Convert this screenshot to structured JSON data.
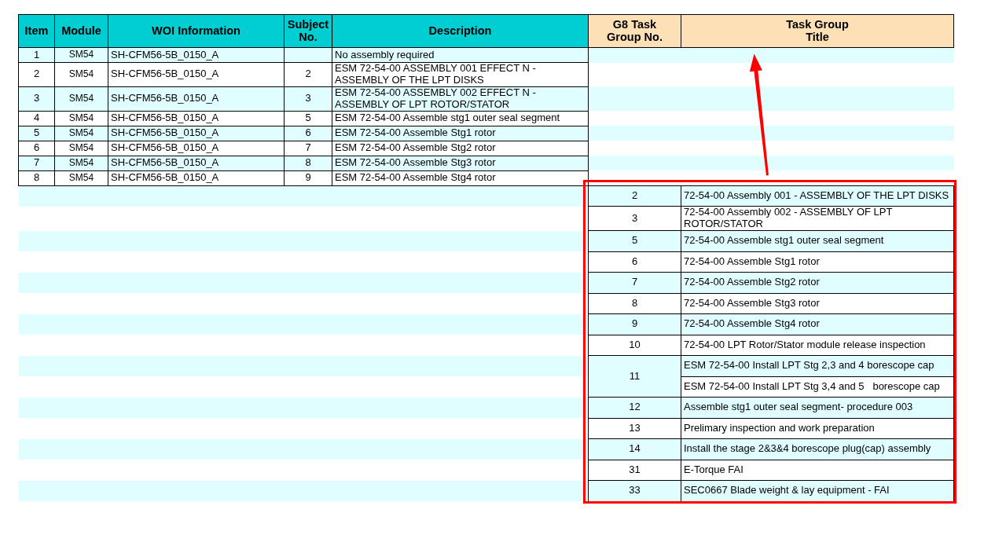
{
  "columns": [
    "Item",
    "Module",
    "WOI Information",
    "Subject No.",
    "Description"
  ],
  "task_columns": [
    "G8 Task Group No.",
    "Task Group Title"
  ],
  "items": [
    {
      "item": "1",
      "module": "SM54",
      "woi": "SH-CFM56-5B_0150_A",
      "description": "No assembly required"
    },
    {
      "item": "2",
      "module": "SM54",
      "woi": "SH-CFM56-5B_0150_A",
      "subject_no": "2",
      "description": "ESM 72-54-00 ASSEMBLY 001 EFFECT N - ASSEMBLY OF THE LPT DISKS"
    },
    {
      "item": "3",
      "module": "SM54",
      "woi": "SH-CFM56-5B_0150_A",
      "subject_no": "3",
      "description": "ESM 72-54-00 ASSEMBLY 002 EFFECT N - ASSEMBLY OF LPT ROTOR/STATOR"
    },
    {
      "item": "4",
      "module": "SM54",
      "woi": "SH-CFM56-5B_0150_A",
      "subject_no": "5",
      "description": "ESM 72-54-00 Assemble stg1 outer seal segment"
    },
    {
      "item": "5",
      "module": "SM54",
      "woi": "SH-CFM56-5B_0150_A",
      "subject_no": "6",
      "description": "ESM 72-54-00 Assemble Stg1 rotor"
    },
    {
      "item": "6",
      "module": "SM54",
      "woi": "SH-CFM56-5B_0150_A",
      "subject_no": "7",
      "description": "ESM 72-54-00 Assemble Stg2 rotor"
    },
    {
      "item": "7",
      "module": "SM54",
      "woi": "SH-CFM56-5B_0150_A",
      "subject_no": "8",
      "description": "ESM 72-54-00 Assemble Stg3 rotor"
    },
    {
      "item": "8",
      "module": "SM54",
      "woi": "SH-CFM56-5B_0150_A",
      "subject_no": "9",
      "description": "ESM 72-54-00 Assemble Stg4 rotor"
    }
  ],
  "task_groups": [
    {
      "number": "2",
      "titles": [
        "72-54-00 Assembly 001 - ASSEMBLY OF THE LPT DISKS"
      ]
    },
    {
      "number": "3",
      "titles": [
        "72-54-00 Assembly 002 - ASSEMBLY OF LPT ROTOR/STATOR"
      ]
    },
    {
      "number": "5",
      "titles": [
        "72-54-00 Assemble stg1 outer seal segment"
      ]
    },
    {
      "number": "6",
      "titles": [
        "72-54-00 Assemble Stg1 rotor"
      ]
    },
    {
      "number": "7",
      "titles": [
        "72-54-00 Assemble Stg2 rotor"
      ]
    },
    {
      "number": "8",
      "titles": [
        "72-54-00 Assemble Stg3 rotor"
      ]
    },
    {
      "number": "9",
      "titles": [
        "72-54-00 Assemble Stg4 rotor"
      ]
    },
    {
      "number": "10",
      "titles": [
        "72-54-00 LPT Rotor/Stator module release inspection"
      ]
    },
    {
      "number": "11",
      "titles": [
        "ESM 72-54-00 Install LPT Stg 2,3 and 4 borescope cap",
        "ESM 72-54-00 Install LPT Stg 3,4 and 5   borescope cap"
      ]
    },
    {
      "number": "12",
      "titles": [
        "Assemble stg1 outer seal segment- procedure 003"
      ]
    },
    {
      "number": "13",
      "titles": [
        "Prelimary inspection and work preparation"
      ]
    },
    {
      "number": "14",
      "titles": [
        "Install the stage 2&3&4 borescope plug(cap) assembly"
      ]
    },
    {
      "number": "31",
      "titles": [
        "E-Torque FAI"
      ]
    },
    {
      "number": "33",
      "titles": [
        "SEC0667 Blade weight & lay equipment - FAI"
      ]
    }
  ]
}
